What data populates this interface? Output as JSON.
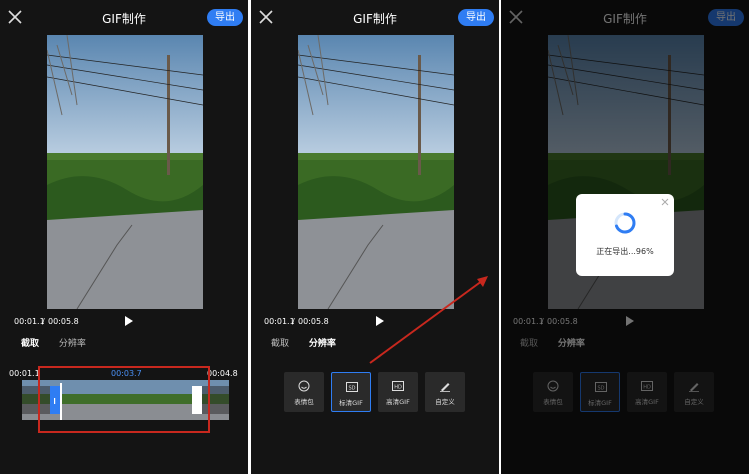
{
  "header": {
    "title": "GIF制作",
    "export_label": "导出"
  },
  "player": {
    "current_time": "00:01.1",
    "separator": "/",
    "total_time": "00:05.8"
  },
  "tabs": [
    "截取",
    "分辨率"
  ],
  "trim": {
    "start_time": "00:01.1",
    "mid_time": "00:03.7",
    "end_time": "00:04.8"
  },
  "quality_options": [
    {
      "label": "表情包",
      "icon": "smile-icon"
    },
    {
      "label": "标清GIF",
      "icon": "sd-icon"
    },
    {
      "label": "高清GIF",
      "icon": "hd-icon"
    },
    {
      "label": "自定义",
      "icon": "pen-icon"
    }
  ],
  "export_dialog": {
    "message": "正在导出...96%",
    "progress": 0.96
  },
  "colors": {
    "accent": "#2f7df3",
    "background": "#141414",
    "highlight": "#c8281e"
  }
}
